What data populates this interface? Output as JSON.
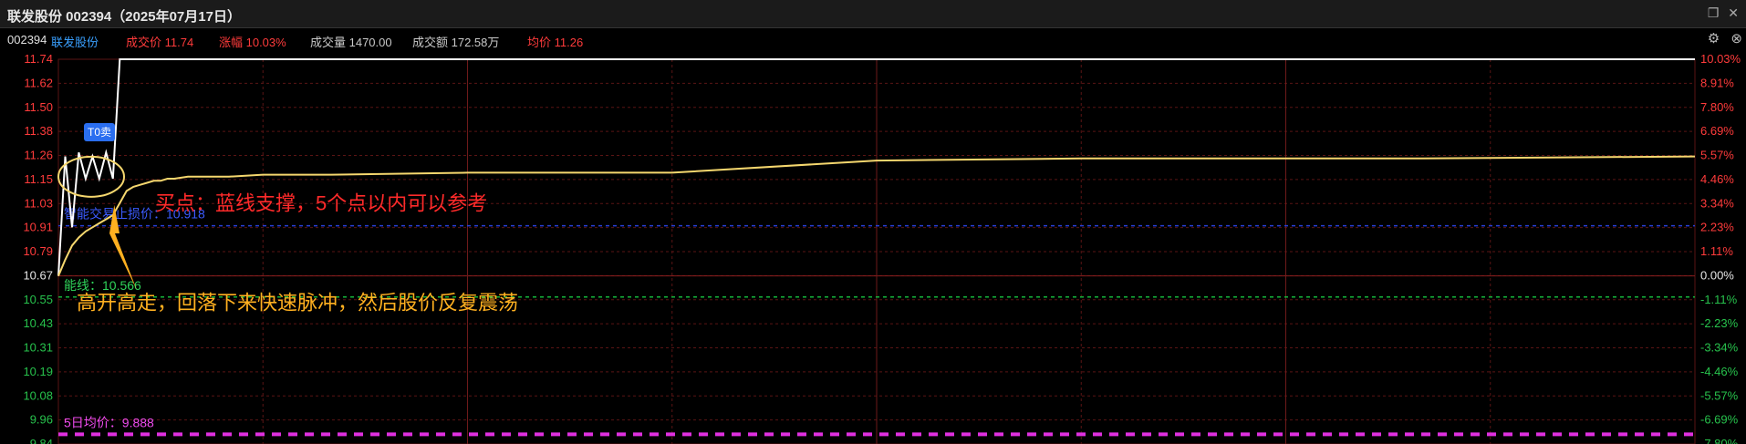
{
  "window": {
    "title": "联发股份 002394（2025年07月17日）"
  },
  "info": {
    "code": "002394",
    "name": "联发股份",
    "price_label": "成交价 11.74",
    "change_label": "涨幅 10.03%",
    "volume_label": "成交量 1470.00",
    "amount_label": "成交额 172.58万",
    "avg_label": "均价 11.26"
  },
  "chart_data": {
    "type": "line",
    "title": "",
    "prev_close": 10.67,
    "ylim": [
      9.84,
      11.74
    ],
    "y_ticks_left": [
      "11.74",
      "11.62",
      "11.50",
      "11.38",
      "11.26",
      "11.15",
      "11.03",
      "10.91",
      "10.79",
      "10.67",
      "10.55",
      "10.43",
      "10.31",
      "10.19",
      "10.08",
      "9.96",
      "9.84"
    ],
    "y_ticks_right": [
      "10.03%",
      "8.91%",
      "7.80%",
      "6.69%",
      "5.57%",
      "4.46%",
      "3.34%",
      "2.23%",
      "1.11%",
      "0.00%",
      "-1.11%",
      "-2.23%",
      "-3.34%",
      "-4.46%",
      "-5.57%",
      "-6.69%",
      "-7.80%"
    ],
    "x": [
      0,
      1,
      2,
      3,
      4,
      5,
      6,
      7,
      8,
      9,
      10,
      11,
      12,
      13,
      14,
      15,
      16,
      17,
      19,
      21,
      23,
      25,
      30,
      40,
      60,
      90,
      120,
      150,
      170,
      200,
      240
    ],
    "series": [
      {
        "values": [
          10.67,
          11.26,
          10.91,
          11.28,
          11.15,
          11.26,
          11.15,
          11.28,
          11.15,
          11.74,
          11.74,
          11.74,
          11.74,
          11.74,
          11.74,
          11.74,
          11.74,
          11.74,
          11.74,
          11.74,
          11.74,
          11.74,
          11.74,
          11.74,
          11.74,
          11.74,
          11.74,
          11.74,
          11.74,
          11.74,
          11.74
        ]
      },
      {
        "values": [
          10.67,
          10.75,
          10.82,
          10.86,
          10.89,
          10.91,
          10.93,
          10.95,
          10.97,
          11.03,
          11.09,
          11.11,
          11.12,
          11.13,
          11.14,
          11.14,
          11.15,
          11.15,
          11.16,
          11.16,
          11.16,
          11.16,
          11.17,
          11.17,
          11.18,
          11.18,
          11.24,
          11.25,
          11.25,
          11.25,
          11.26
        ]
      }
    ],
    "reference_lines": [
      {
        "label": "智能交易止损价：10.918",
        "value": 10.918,
        "color": "#2a3fd8"
      },
      {
        "label": "能线：10.566",
        "value": 10.566,
        "color": "#16b53a"
      },
      {
        "label": "5日均价：9.888",
        "value": 9.888,
        "color": "#e030e0"
      }
    ],
    "annotations": {
      "tag": "T0卖",
      "buy_note": "买点：蓝线支撑，5个点以内可以参考",
      "open_note": "高开高走，回落下来快速脉冲，然后股价反复震荡"
    }
  },
  "colors": {
    "up": "#ff3b3b",
    "down": "#27c24c",
    "grid": "#5a1414",
    "price_line": "#ffffff",
    "avg_line": "#f5d76e",
    "note_red": "#ff2a2a",
    "note_orange": "#ffb020"
  },
  "icons": [
    "restore-icon",
    "close-icon",
    "gear-icon",
    "close-circle-icon"
  ]
}
